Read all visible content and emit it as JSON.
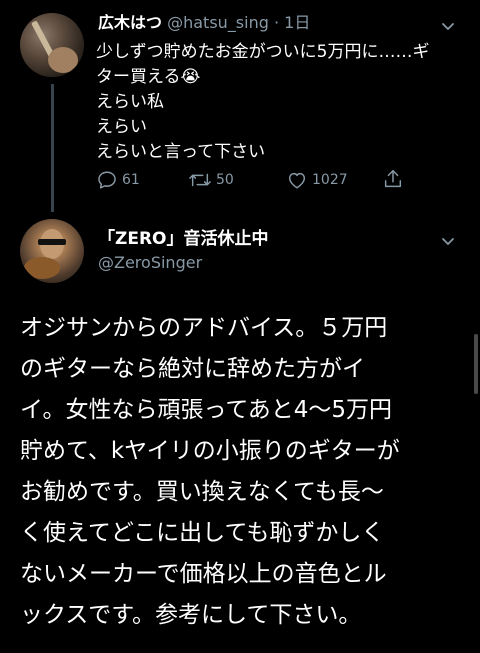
{
  "tweet1": {
    "name": "広木はつ",
    "handle": "@hatsu_sing",
    "time": "· 1日",
    "lines": [
      "少しずつ貯めたお金がついに5万円に……ギ",
      "ター買える😭",
      "えらい私",
      "えらい",
      "えらいと言って下さい"
    ],
    "actions": {
      "reply": "61",
      "retweet": "50",
      "like": "1027"
    },
    "icons": {
      "caret": "chevron-down-icon",
      "reply": "reply-icon",
      "retweet": "retweet-icon",
      "like": "heart-icon",
      "share": "share-icon"
    }
  },
  "tweet2": {
    "name": "「ZERO」音活休止中",
    "handle": "@ZeroSinger",
    "lines": [
      "オジサンからのアドバイス。５万円",
      "のギターなら絶対に辞めた方がイ",
      "イ。女性なら頑張ってあと4〜5万円",
      "貯めて、kヤイリの小振りのギターが",
      "お勧めです。買い換えなくても長〜",
      "く使えてどこに出しても恥ずかしく",
      "ないメーカーで価格以上の音色とル",
      "ックスです。参考にして下さい。"
    ]
  },
  "theme": {
    "background": "#000000",
    "text": "#ffffff",
    "muted": "#8899a6",
    "thread_line": "#38444d"
  }
}
